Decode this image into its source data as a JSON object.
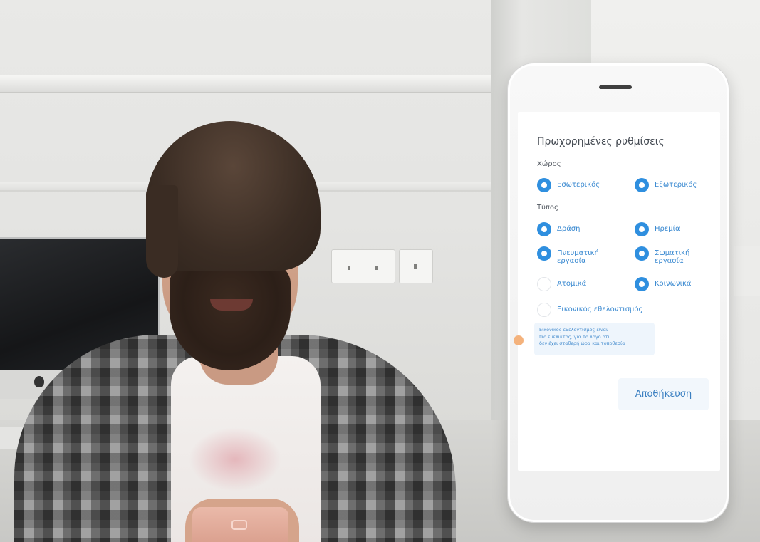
{
  "settings": {
    "title": "Πρωχορημένες ρυθμίσεις",
    "space_label": "Χώρος",
    "space_options": [
      {
        "label": "Εσωτερικός",
        "selected": true
      },
      {
        "label": "Εξωτερικός",
        "selected": true
      }
    ],
    "type_label": "Τύπος",
    "type_options": [
      {
        "label": "Δράση",
        "selected": true
      },
      {
        "label": "Ηρεμία",
        "selected": true
      },
      {
        "label": "Πνευματική\nεργασία",
        "selected": true
      },
      {
        "label": "Σωματική\nεργασία",
        "selected": true
      },
      {
        "label": "Ατομικά",
        "selected": false
      },
      {
        "label": "Κοινωνικά",
        "selected": true
      },
      {
        "label": "Εικονικός εθελοντισμός",
        "selected": false
      }
    ],
    "note": "Εικονικός εθελοντισμός είναι\n πιο ευέλικτος, για το λόγο ότι\n δεν έχει σταθερή ώρα και τοποθεσία",
    "save_label": "Αποθήκευση"
  },
  "colors": {
    "accent": "#2f8fdf",
    "option_text": "#3b8ad1",
    "note_bg": "#eef5fc"
  }
}
